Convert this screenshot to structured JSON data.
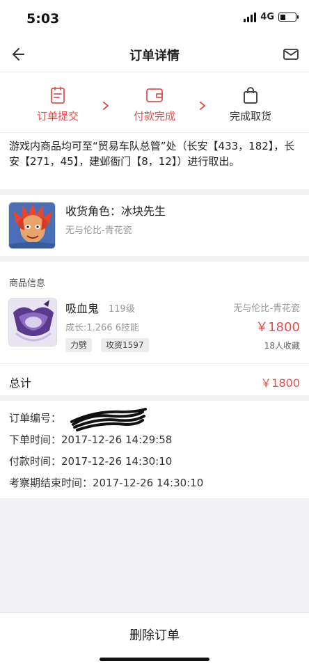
{
  "status_bar": {
    "time": "5:03",
    "network": "4G",
    "battery_level": 0.35
  },
  "nav": {
    "title": "订单详情",
    "back_icon": "back-arrow-icon",
    "mail_icon": "mail-icon"
  },
  "steps": [
    {
      "label": "订单提交",
      "icon": "clipboard-icon",
      "state": "done"
    },
    {
      "label": "付款完成",
      "icon": "wallet-icon",
      "state": "done"
    },
    {
      "label": "完成取货",
      "icon": "shopping-bag-icon",
      "state": "todo"
    }
  ],
  "colors": {
    "accent": "#e0504d",
    "muted": "#999999"
  },
  "notice": "游戏内商品均可至“贸易车队总管”处（长安【433，182】，长安【271，45】，建邺衙门【8，12】）进行取出。",
  "role": {
    "name_line": "收货角色：冰块先生",
    "server": "无与伦比-青花瓷"
  },
  "goods": {
    "section_title": "商品信息",
    "name": "吸血鬼",
    "level": "119级",
    "server": "无与伦比-青花瓷",
    "growth": "成长:1.266 6技能",
    "price": "￥1800",
    "tags": [
      "力劈",
      "攻资1597"
    ],
    "favorites": "18人收藏"
  },
  "total": {
    "label": "总计",
    "value": "￥1800"
  },
  "order": {
    "number_label": "订单编号：",
    "created_label": "下单时间：",
    "created": "2017-12-26 14:29:58",
    "paid_label": "付款时间：",
    "paid": "2017-12-26 14:30:10",
    "inspect_label": "考察期结束时间：",
    "inspect": "2017-12-26 14:30:10"
  },
  "bottom": {
    "delete_label": "删除订单"
  }
}
